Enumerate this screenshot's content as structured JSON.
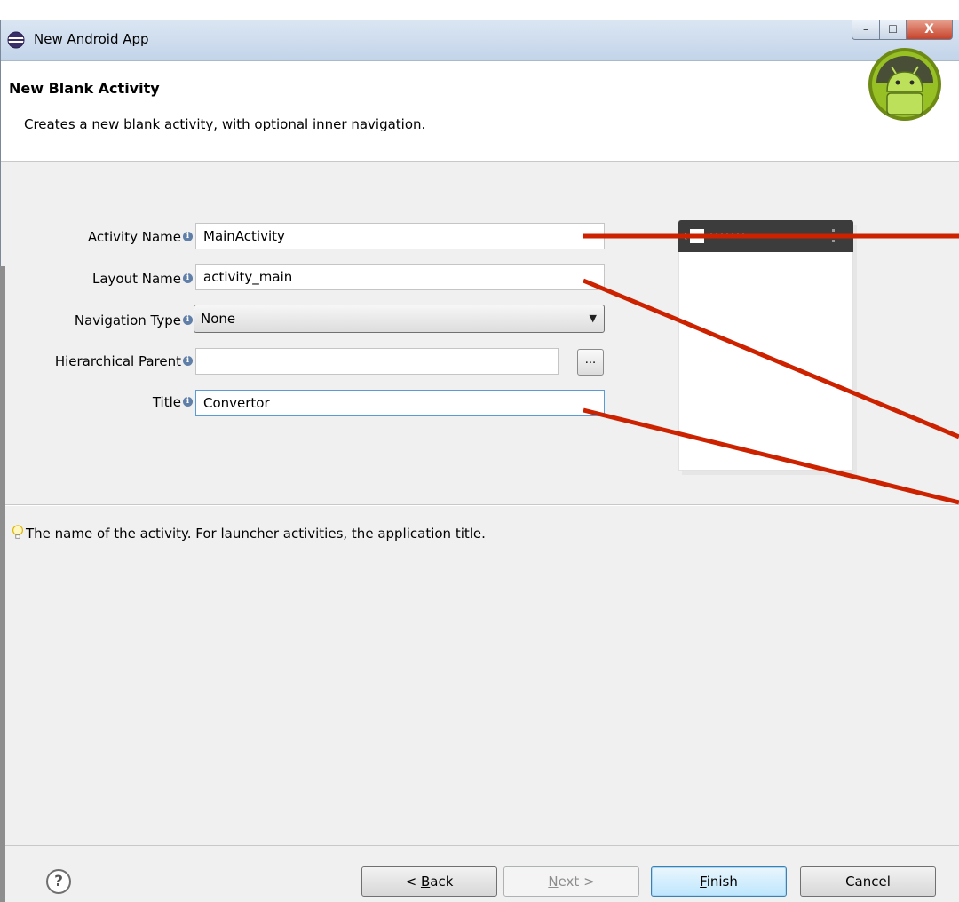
{
  "window": {
    "title": "New Android App",
    "controls": {
      "minimize": "–",
      "maximize": "☐",
      "close": "X"
    }
  },
  "header": {
    "title": "New Blank Activity",
    "description": "Creates a new blank activity, with optional inner navigation."
  },
  "form": {
    "activity_name": {
      "label": "Activity Name",
      "value": "MainActivity"
    },
    "layout_name": {
      "label": "Layout Name",
      "value": "activity_main"
    },
    "navigation_type": {
      "label": "Navigation Type",
      "value": "None"
    },
    "hierarchical_parent": {
      "label": "Hierarchical Parent",
      "value": "",
      "browse_label": "..."
    },
    "title": {
      "label": "Title",
      "value": "Convertor"
    },
    "info_glyph": "i"
  },
  "hint": "The name of the activity. For launcher activities, the application title.",
  "footer": {
    "help": "?",
    "back": {
      "mnemonic": "B",
      "rest": "ack",
      "prefix": "< "
    },
    "next": {
      "mnemonic": "N",
      "rest": "ext >"
    },
    "finish": {
      "mnemonic": "F",
      "rest": "inish"
    },
    "cancel": "Cancel"
  },
  "colors": {
    "annotation_line": "#cc2200",
    "android_green": "#97c024"
  }
}
